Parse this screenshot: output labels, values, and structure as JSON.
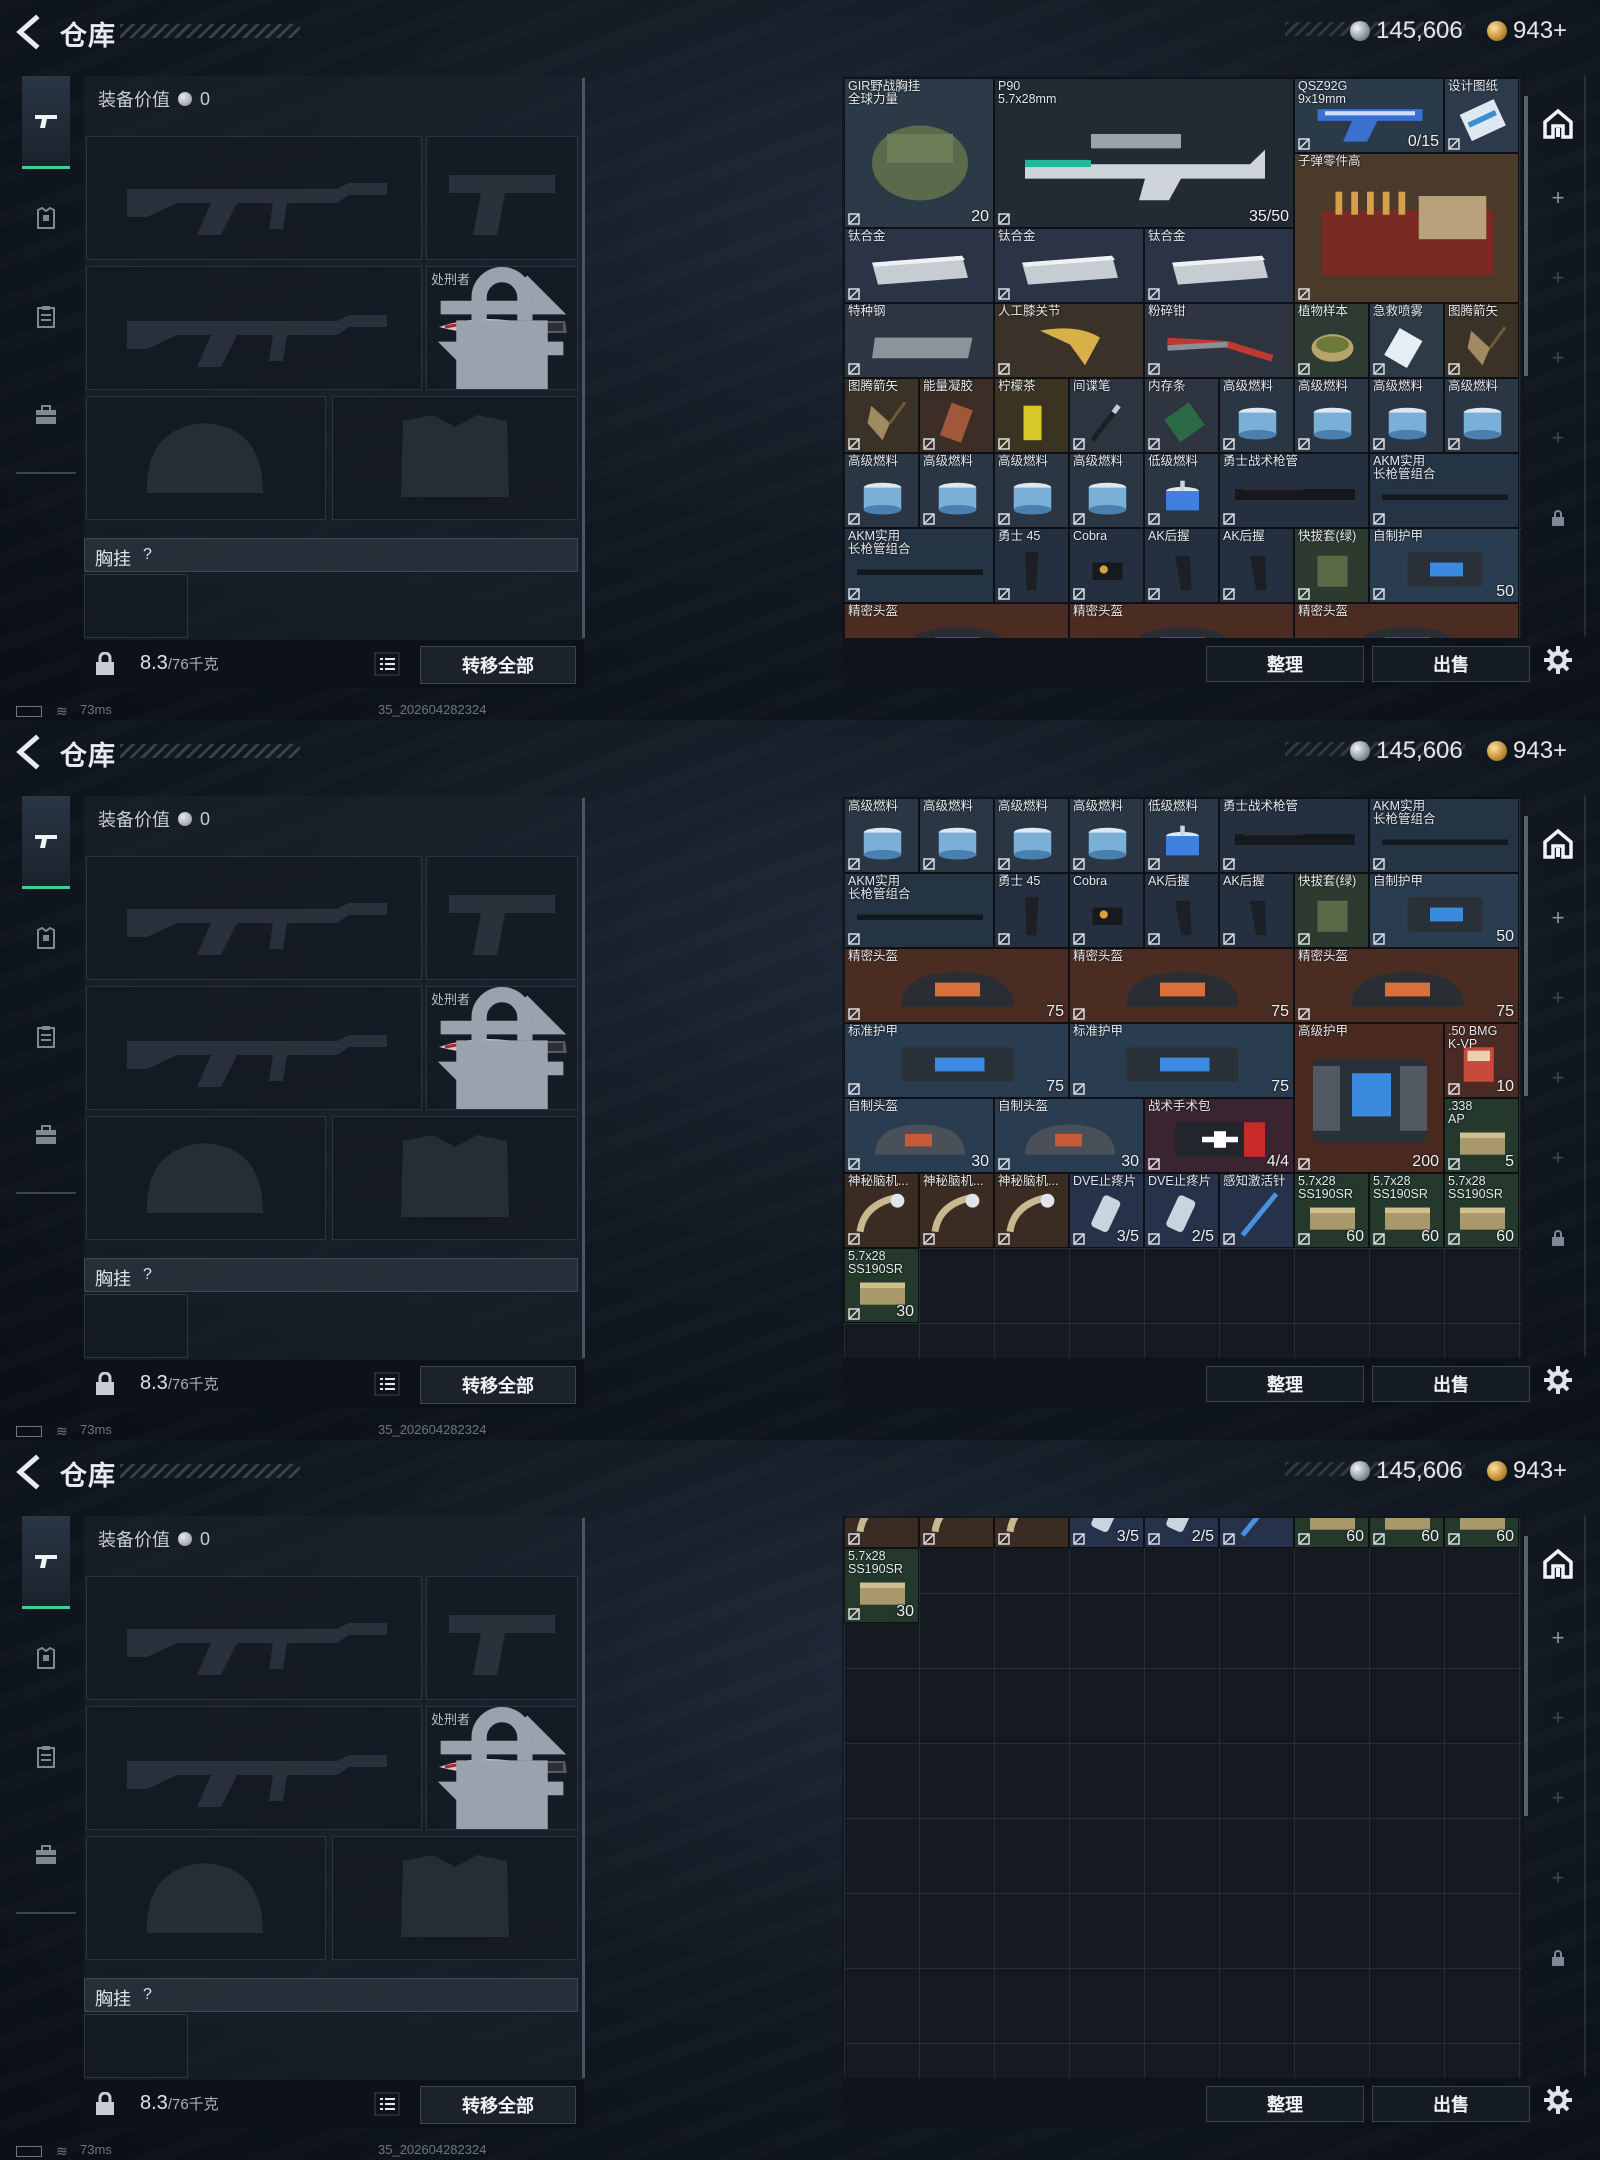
{
  "screens": [
    {
      "id": "s1"
    },
    {
      "id": "s2"
    },
    {
      "id": "s3"
    }
  ],
  "header": {
    "title": "仓库",
    "money": "145,606",
    "gold": "943+"
  },
  "equipment": {
    "value_label": "装备价值",
    "value": "0",
    "knife_slot_label": "处刑者",
    "chest_label": "胸挂",
    "chest_help": "?",
    "weight": "8.3",
    "weight_cap": "/76千克",
    "transfer_all": "转移全部"
  },
  "warehouse": {
    "sort_label": "整理",
    "sell_label": "出售",
    "items_screen1": [
      {
        "name": "GIR野战胸挂\n全球力量",
        "count": "20",
        "icon": "chest-rig"
      },
      {
        "name": "P90\n5.7x28mm",
        "count": "35/50",
        "icon": "p90-rifle"
      },
      {
        "name": "QSZ92G\n9x19mm",
        "count": "0/15",
        "icon": "pistol"
      },
      {
        "name": "设计图纸",
        "count": "",
        "icon": "blueprint"
      },
      {
        "name": "子弹零件高",
        "count": "",
        "icon": "ammo-parts-box"
      },
      {
        "name": "钛合金",
        "count": "",
        "icon": "titanium-plate"
      },
      {
        "name": "钛合金",
        "count": "",
        "icon": "titanium-plate"
      },
      {
        "name": "钛合金",
        "count": "",
        "icon": "titanium-plate"
      },
      {
        "name": "特种钢",
        "count": "",
        "icon": "steel-bar"
      },
      {
        "name": "人工膝关节",
        "count": "",
        "icon": "knee-joint"
      },
      {
        "name": "粉碎钳",
        "count": "",
        "icon": "pliers"
      },
      {
        "name": "植物样本",
        "count": "",
        "icon": "plant-sample"
      },
      {
        "name": "急救喷雾",
        "count": "",
        "icon": "spray"
      },
      {
        "name": "图腾箭矢",
        "count": "",
        "icon": "arrow"
      },
      {
        "name": "图腾箭矢",
        "count": "",
        "icon": "arrow"
      },
      {
        "name": "能量凝胶",
        "count": "",
        "icon": "gel"
      },
      {
        "name": "柠檬茶",
        "count": "",
        "icon": "can"
      },
      {
        "name": "间谍笔",
        "count": "",
        "icon": "pen"
      },
      {
        "name": "内存条",
        "count": "",
        "icon": "ram"
      },
      {
        "name": "高级燃料",
        "count": "",
        "icon": "fuel"
      },
      {
        "name": "低级燃料",
        "count": "",
        "icon": "fuel-low"
      },
      {
        "name": "勇士战术枪管",
        "count": "",
        "icon": "barrel"
      },
      {
        "name": "AKM实用\n长枪管组合",
        "count": "",
        "icon": "barrel-long"
      },
      {
        "name": "勇士 45",
        "count": "",
        "icon": "magazine"
      },
      {
        "name": "Cobra",
        "count": "",
        "icon": "sight"
      },
      {
        "name": "AK后握",
        "count": "",
        "icon": "grip"
      },
      {
        "name": "快拔套(绿)",
        "count": "",
        "icon": "holster"
      },
      {
        "name": "自制护甲",
        "count": "50",
        "icon": "armor"
      },
      {
        "name": "精密头盔",
        "count": "75",
        "icon": "helmet"
      }
    ],
    "items_screen2": [
      {
        "name": "标准护甲",
        "count": "75",
        "icon": "armor"
      },
      {
        "name": "高级护甲",
        "count": "200",
        "icon": "armor-heavy"
      },
      {
        "name": ".50 BMG\nK-VP",
        "count": "10",
        "icon": "ammo"
      },
      {
        "name": "自制头盔",
        "count": "30",
        "icon": "helmet-homemade"
      },
      {
        "name": "战术手术包",
        "count": "4/4",
        "icon": "medkit"
      },
      {
        "name": ".338\nAP",
        "count": "5",
        "icon": "ammo-box"
      },
      {
        "name": "神秘脑机...",
        "count": "",
        "icon": "brain-device"
      },
      {
        "name": "DVE止疼片",
        "count": "3/5",
        "icon": "pills"
      },
      {
        "name": "DVE止疼片",
        "count": "2/5",
        "icon": "pills"
      },
      {
        "name": "感知激活针",
        "count": "",
        "icon": "syringe"
      },
      {
        "name": "5.7x28\nSS190SR",
        "count": "60",
        "icon": "ammo-box"
      },
      {
        "name": "5.7x28\nSS190SR",
        "count": "30",
        "icon": "ammo-box"
      }
    ]
  },
  "status_bar": {
    "ping": "73ms",
    "build": "35_202604282324"
  }
}
